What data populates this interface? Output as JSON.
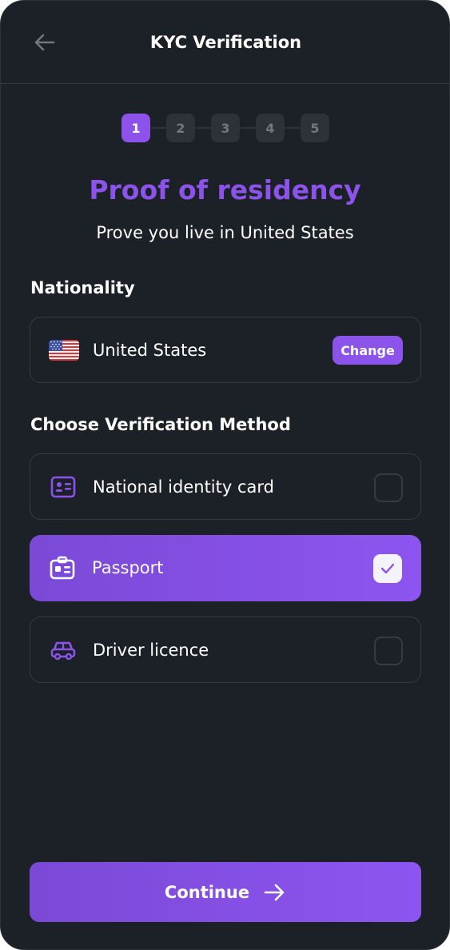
{
  "header": {
    "title": "KYC Verification"
  },
  "stepper": {
    "steps": [
      "1",
      "2",
      "3",
      "4",
      "5"
    ],
    "active_step": 1
  },
  "page": {
    "title": "Proof of residency",
    "subtitle": "Prove you live in United States"
  },
  "nationality": {
    "label": "Nationality",
    "country": "United States",
    "flag_icon": "us-flag-icon",
    "change_label": "Change"
  },
  "methods": {
    "label": "Choose Verification Method",
    "items": [
      {
        "label": "National identity card",
        "icon": "id-card-icon",
        "selected": false
      },
      {
        "label": "Passport",
        "icon": "passport-icon",
        "selected": true
      },
      {
        "label": "Driver licence",
        "icon": "car-icon",
        "selected": false
      }
    ]
  },
  "footer": {
    "continue_label": "Continue"
  },
  "colors": {
    "background": "#1c2127",
    "accent": "#8b53ea",
    "border": "#353b42",
    "inactive_step": "#2c3238"
  }
}
